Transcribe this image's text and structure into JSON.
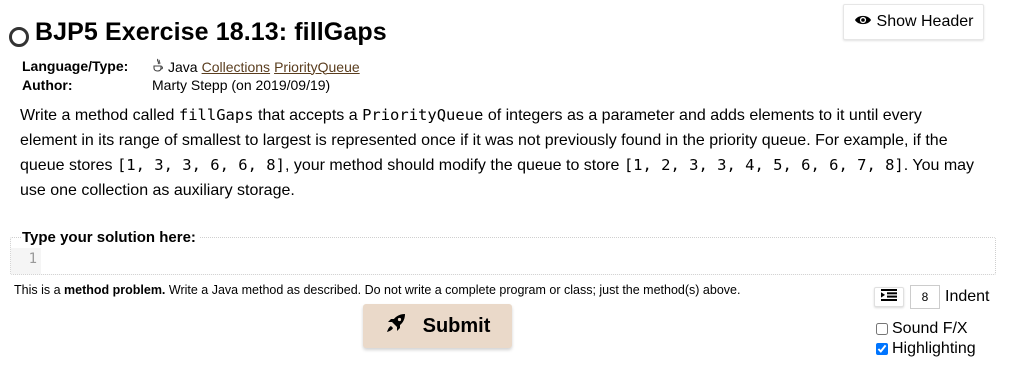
{
  "header": {
    "show_header_label": "Show Header",
    "title": "BJP5 Exercise 18.13: fillGaps"
  },
  "meta": {
    "language_label": "Language/Type:",
    "language_value": "Java",
    "tags": [
      "Collections",
      "PriorityQueue"
    ],
    "author_label": "Author:",
    "author_value": "Marty Stepp (on 2019/09/19)"
  },
  "description": {
    "t1": "Write a method called ",
    "c1": "fillGaps",
    "t2": " that accepts a ",
    "c2": "PriorityQueue",
    "t3": " of integers as a parameter and adds elements to it until every element in its range of smallest to largest is represented once if it was not previously found in the priority queue. For example, if the queue stores ",
    "c3": "[1, 3, 3, 6, 6, 8]",
    "t4": ", your method should modify the queue to store ",
    "c4": "[1, 2, 3, 3, 4, 5, 6, 6, 7, 8]",
    "t5": ". You may use one collection as auxiliary storage."
  },
  "editor": {
    "label": "Type your solution here:",
    "line_number": "1",
    "code": ""
  },
  "note": {
    "prefix": "This is a ",
    "bold": "method problem.",
    "suffix": " Write a Java method as described. Do not write a complete program or class; just the method(s) above."
  },
  "submit": {
    "label": "Submit"
  },
  "options": {
    "indent_value": "8",
    "indent_label": "Indent",
    "sound_label": "Sound F/X",
    "sound_checked": false,
    "highlighting_label": "Highlighting",
    "highlighting_checked": true
  }
}
